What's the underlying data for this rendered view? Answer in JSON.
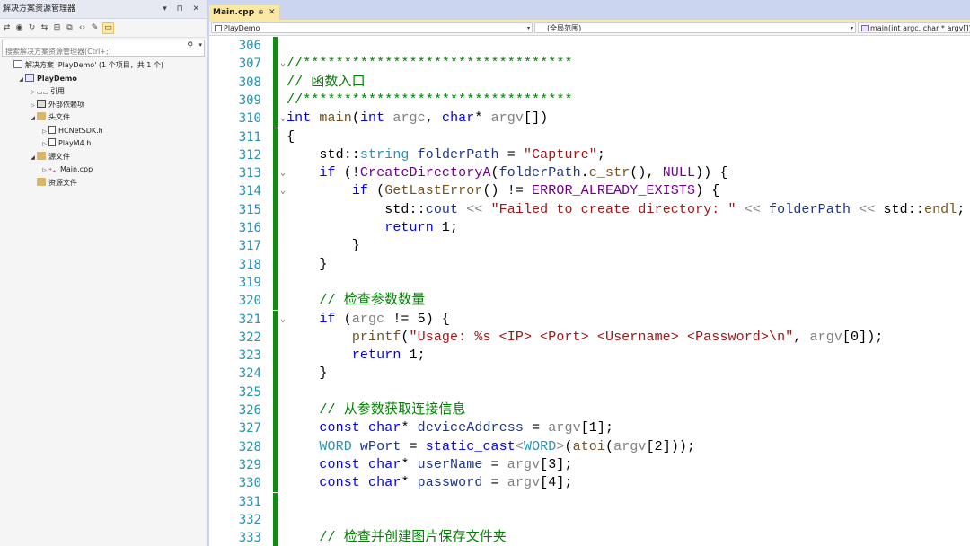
{
  "solution_explorer": {
    "title": "解决方案资源管理器",
    "window_controls": "▾ ⊓ ✕",
    "search_placeholder": "搜索解决方案资源管理器(Ctrl+;)",
    "tree": [
      {
        "label": "解决方案 'PlayDemo' (1 个项目，共 1 个)",
        "indent": 0,
        "arrow": "",
        "icon": "solution-icon",
        "bold": false
      },
      {
        "label": "PlayDemo",
        "indent": 1,
        "arrow": "◢",
        "icon": "project-icon",
        "bold": true
      },
      {
        "label": "引用",
        "indent": 2,
        "arrow": "▷",
        "icon": "references-icon",
        "bold": false
      },
      {
        "label": "外部依赖项",
        "indent": 2,
        "arrow": "▷",
        "icon": "external-deps-icon",
        "bold": false
      },
      {
        "label": "头文件",
        "indent": 2,
        "arrow": "◢",
        "icon": "folder-icon",
        "bold": false
      },
      {
        "label": "HCNetSDK.h",
        "indent": 3,
        "arrow": "▷",
        "icon": "header-file-icon",
        "bold": false
      },
      {
        "label": "PlayM4.h",
        "indent": 3,
        "arrow": "▷",
        "icon": "header-file-icon",
        "bold": false
      },
      {
        "label": "源文件",
        "indent": 2,
        "arrow": "◢",
        "icon": "folder-icon",
        "bold": false
      },
      {
        "label": "Main.cpp",
        "indent": 3,
        "arrow": "▷",
        "icon": "cpp-file-icon",
        "bold": false
      },
      {
        "label": "资源文件",
        "indent": 2,
        "arrow": "",
        "icon": "folder-icon",
        "bold": false
      }
    ]
  },
  "tab": {
    "label": "Main.cpp",
    "pin": "⊕",
    "close": "✕"
  },
  "navbar": {
    "project": "PlayDemo",
    "scope": "(全局范围)",
    "function": "main(int argc, char * argv[])"
  },
  "code_lines": [
    {
      "n": "306",
      "html": ""
    },
    {
      "n": "307",
      "fold": "⌄",
      "html": "<span class=\"cm\">//*********************************</span>"
    },
    {
      "n": "308",
      "html": "<span class=\"cm\">// 函数入口</span>"
    },
    {
      "n": "309",
      "html": "<span class=\"cm\">//*********************************</span>"
    },
    {
      "n": "310",
      "fold": "⌄",
      "html": "<span class=\"kw\">int</span> <span class=\"fn\">main</span>(<span class=\"kw\">int</span> <span class=\"pa\">argc</span>, <span class=\"kw\">char</span>* <span class=\"pa\">argv</span>[])"
    },
    {
      "n": "311",
      "html": "{"
    },
    {
      "n": "312",
      "html": "    std::<span class=\"ty\">string</span> <span class=\"var\">folderPath</span> = <span class=\"str\">\"Capture\"</span>;"
    },
    {
      "n": "313",
      "fold": "⌄",
      "html": "    <span class=\"kw\">if</span> (!<span class=\"mc\">CreateDirectoryA</span>(<span class=\"var\">folderPath</span>.<span class=\"fn\">c_str</span>(), <span class=\"mc\">NULL</span>)) {"
    },
    {
      "n": "314",
      "fold": "⌄",
      "html": "        <span class=\"kw\">if</span> (<span class=\"fn\">GetLastError</span>() != <span class=\"mc\">ERROR_ALREADY_EXISTS</span>) {"
    },
    {
      "n": "315",
      "html": "            std::<span class=\"var\">cout</span> <span class=\"pa\">&lt;&lt;</span> <span class=\"str\">\"Failed to create directory: \"</span> <span class=\"pa\">&lt;&lt;</span> <span class=\"var\">folderPath</span> <span class=\"pa\">&lt;&lt;</span> std::<span class=\"fn\">endl</span>;"
    },
    {
      "n": "316",
      "html": "            <span class=\"kw\">return</span> 1;"
    },
    {
      "n": "317",
      "html": "        }"
    },
    {
      "n": "318",
      "html": "    }"
    },
    {
      "n": "319",
      "html": ""
    },
    {
      "n": "320",
      "html": "    <span class=\"cm\">// 检查参数数量</span>"
    },
    {
      "n": "321",
      "fold": "⌄",
      "html": "    <span class=\"kw\">if</span> (<span class=\"pa\">argc</span> != 5) {"
    },
    {
      "n": "322",
      "html": "        <span class=\"fn\">printf</span>(<span class=\"str\">\"Usage: %s &lt;IP&gt; &lt;Port&gt; &lt;Username&gt; &lt;Password&gt;\\n\"</span>, <span class=\"pa\">argv</span>[0]);"
    },
    {
      "n": "323",
      "html": "        <span class=\"kw\">return</span> 1;"
    },
    {
      "n": "324",
      "html": "    }"
    },
    {
      "n": "325",
      "html": ""
    },
    {
      "n": "326",
      "html": "    <span class=\"cm\">// 从参数获取连接信息</span>"
    },
    {
      "n": "327",
      "html": "    <span class=\"kw\">const</span> <span class=\"kw\">char</span>* <span class=\"var\">deviceAddress</span> = <span class=\"pa\">argv</span>[1];"
    },
    {
      "n": "328",
      "html": "    <span class=\"ty\">WORD</span> <span class=\"var\">wPort</span> = <span class=\"kw\">static_cast</span><span class=\"pa\">&lt;</span><span class=\"ty\">WORD</span><span class=\"pa\">&gt;</span>(<span class=\"fn\">atoi</span>(<span class=\"pa\">argv</span>[2]));"
    },
    {
      "n": "329",
      "html": "    <span class=\"kw\">const</span> <span class=\"kw\">char</span>* <span class=\"var\">userName</span> = <span class=\"pa\">argv</span>[3];"
    },
    {
      "n": "330",
      "html": "    <span class=\"kw\">const</span> <span class=\"kw\">char</span>* <span class=\"var\">password</span> = <span class=\"pa\">argv</span>[4];"
    },
    {
      "n": "331",
      "html": ""
    },
    {
      "n": "332",
      "html": ""
    },
    {
      "n": "333",
      "html": "    <span class=\"cm\">// 检查并创建图片保存文件夹</span>"
    }
  ]
}
